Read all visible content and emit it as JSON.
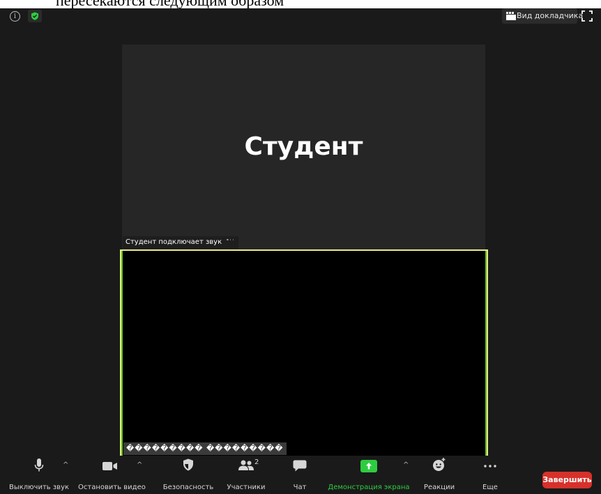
{
  "document_text": "пересекаются следующим образом",
  "header": {
    "speaker_view_label": "Вид докладчика"
  },
  "speaker_tile": {
    "name": "Студент",
    "status": "Студент подключает звук"
  },
  "video_tile": {
    "name_label": "��������� ���������"
  },
  "toolbar": {
    "mute_label": "Выключить звук",
    "stop_video_label": "Остановить видео",
    "security_label": "Безопасность",
    "participants_label": "Участники",
    "participants_count": "2",
    "chat_label": "Чат",
    "share_screen_label": "Демонстрация экрана",
    "reactions_label": "Реакции",
    "more_label": "Еще",
    "end_label": "Завершить"
  },
  "colors": {
    "share_green": "#2ecc40",
    "end_red": "#d6312b",
    "active_border": "#e7ea8a",
    "background": "#1a1a1a"
  }
}
